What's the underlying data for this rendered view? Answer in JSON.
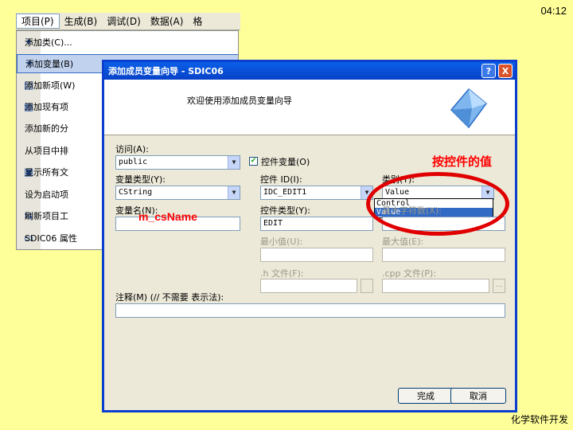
{
  "clock": "04:12",
  "footer": "化学软件开发",
  "menubar": {
    "items": [
      "项目(P)",
      "生成(B)",
      "调试(D)",
      "数据(A)",
      "格"
    ]
  },
  "menu": {
    "items": [
      {
        "label": "添加类(C)...",
        "icon": "add-class-icon"
      },
      {
        "label": "添加变量(B)",
        "icon": "add-variable-icon"
      },
      {
        "label": "添加新项(W)",
        "icon": "add-new-item-icon"
      },
      {
        "label": "添加现有项",
        "icon": "add-existing-item-icon"
      },
      {
        "label": "添加新的分",
        "icon": ""
      },
      {
        "label": "从项目中排",
        "icon": ""
      },
      {
        "label": "显示所有文",
        "icon": "show-all-files-icon"
      },
      {
        "label": "设为启动项",
        "icon": ""
      },
      {
        "label": "刷新项目工",
        "icon": "refresh-icon"
      },
      {
        "label": "SDIC06 属性",
        "icon": "properties-icon"
      }
    ]
  },
  "dialog": {
    "title": "添加成员变量向导 - SDIC06",
    "help": "?",
    "close": "X",
    "welcome": "欢迎使用添加成员变量向导",
    "access_label": "访问(A):",
    "access_value": "public",
    "control_var_label": "控件变量(O)",
    "var_type_label": "变量类型(Y):",
    "var_type_value": "CString",
    "control_id_label": "控件 ID(I):",
    "control_id_value": "IDC_EDIT1",
    "category_label": "类别(T):",
    "category_value": "Value",
    "category_options": [
      "Control",
      "Value"
    ],
    "var_name_label": "变量名(N):",
    "var_name_value": "m_csName",
    "control_type_label": "控件类型(Y):",
    "control_type_value": "EDIT",
    "max_chars_label": "最大字符数(X):",
    "min_label": "最小值(U):",
    "max_label": "最大值(E):",
    "h_file_label": ".h 文件(F):",
    "cpp_file_label": ".cpp 文件(P):",
    "browse_small": "...",
    "comment_label": "注释(M) (// 不需要 表示法):",
    "finish_button": "完成",
    "cancel_button": "取消"
  },
  "annotation": {
    "hint": "按控件的值",
    "accent_color": "#ff0000"
  }
}
